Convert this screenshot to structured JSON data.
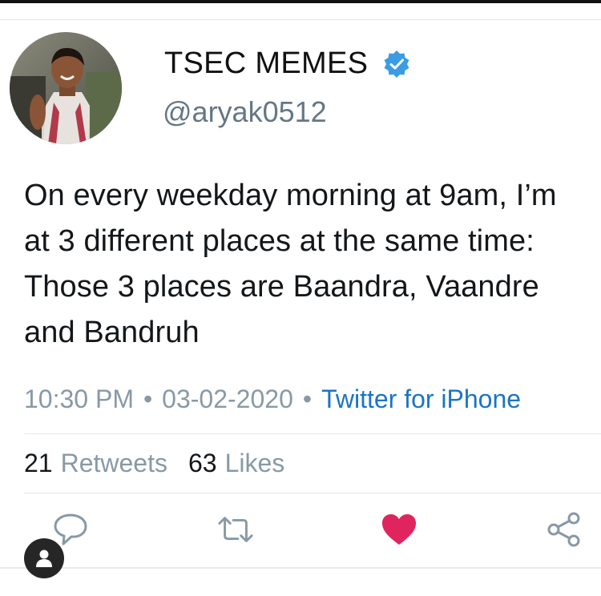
{
  "tweet": {
    "display_name": "TSEC MEMES",
    "handle": "@aryak0512",
    "verified": true,
    "verified_icon": "verified-badge-icon",
    "text_lines": [
      "On every weekday morning at 9am, I’m",
      "at 3 different places at the same time:",
      "Those 3 places are Baandra, Vaandre",
      "and Bandruh"
    ],
    "time": "10:30 PM",
    "date": "03-02-2020",
    "separator": "•",
    "source": "Twitter for iPhone",
    "retweets_count": "21",
    "retweets_label": "Retweets",
    "likes_count": "63",
    "likes_label": "Likes"
  },
  "actions": {
    "reply_icon": "reply-icon",
    "retweet_icon": "retweet-icon",
    "like_icon": "heart-icon",
    "share_icon": "share-icon"
  },
  "overlay": {
    "profile_icon": "person-icon"
  },
  "colors": {
    "accent_blue": "#1b74c4",
    "verified_blue": "#3b9ce4",
    "like_red": "#e0245e",
    "muted": "#8899a6"
  }
}
